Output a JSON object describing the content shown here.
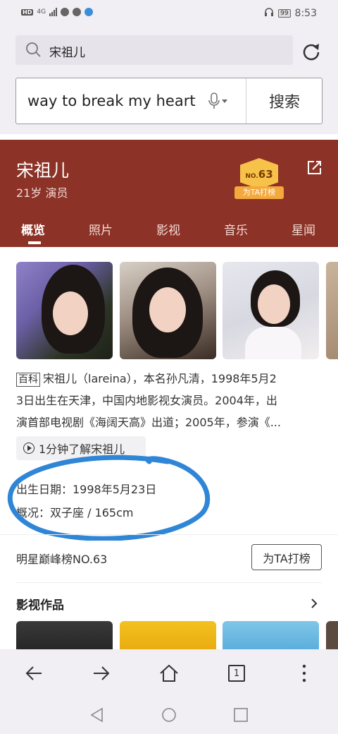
{
  "status_bar": {
    "hd": "HD",
    "network": "4G",
    "battery": "99",
    "time": "8:53"
  },
  "search": {
    "query": "宋祖儿",
    "input_value": "way to break my heart",
    "submit_label": "搜索"
  },
  "profile": {
    "name": "宋祖儿",
    "subtitle": "21岁 演员",
    "rank_badge": "NO.63",
    "rank_badge_no": "NO.",
    "rank_badge_num": "63",
    "rank_cta": "为TA打榜",
    "tabs": [
      "概览",
      "照片",
      "影视",
      "音乐",
      "星闻"
    ],
    "active_tab": "概览"
  },
  "summary": {
    "source_tag": "百科",
    "text_lines": [
      "宋祖儿（lareina），本名孙凡清，1998年5月2",
      "3日出生在天津，中国内地影视女演员。2004年，出",
      "演首部电视剧《海阔天高》出道；2005年，参演《..."
    ],
    "video_chip": "1分钟了解宋祖儿",
    "birth_label": "出生日期：1998年5月23日",
    "overview_label": "概况：双子座 / 165cm"
  },
  "ranking": {
    "text": "明星巅峰榜NO.63",
    "button": "为TA打榜"
  },
  "works": {
    "title": "影视作品"
  },
  "browser_nav": {
    "tab_count": "1"
  },
  "colors": {
    "hero_bg": "#8c3227",
    "badge_gold": "#f6c24a",
    "annotation_blue": "#2f86d6"
  }
}
